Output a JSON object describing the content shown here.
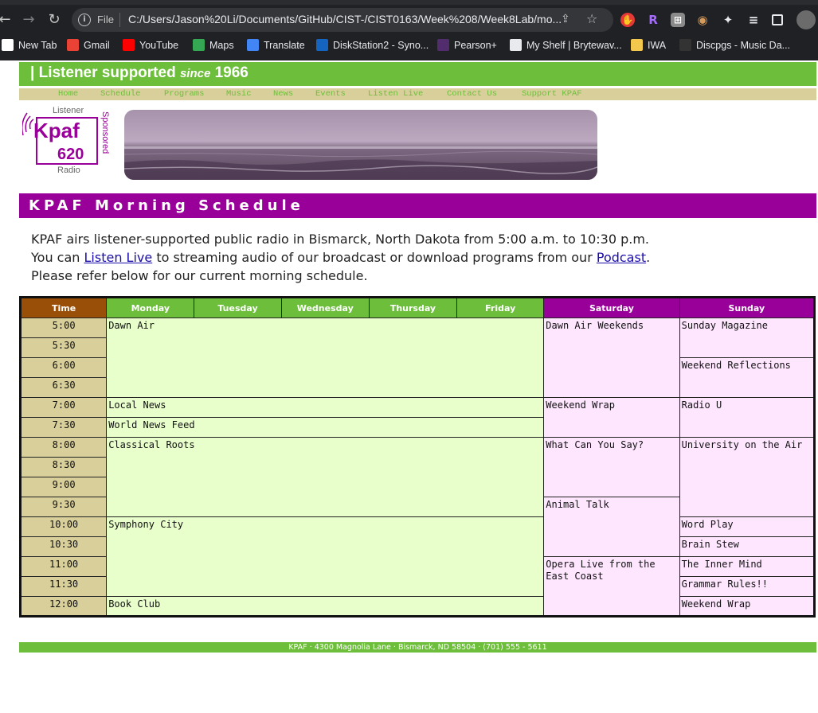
{
  "browser": {
    "url_scheme": "File",
    "url": "C:/Users/Jason%20Li/Documents/GitHub/CIST-/CIST0163/Week%208/Week8Lab/mo...",
    "bookmarks": [
      {
        "label": "New Tab",
        "icon": "grid-icon",
        "color": "#ffffff"
      },
      {
        "label": "Gmail",
        "icon": "gmail-icon",
        "color": "#ea4335"
      },
      {
        "label": "YouTube",
        "icon": "youtube-icon",
        "color": "#ff0000"
      },
      {
        "label": "Maps",
        "icon": "maps-icon",
        "color": "#34a853"
      },
      {
        "label": "Translate",
        "icon": "translate-icon",
        "color": "#4285f4"
      },
      {
        "label": "DiskStation2 - Syno...",
        "icon": "dsm-icon",
        "color": "#1565c0"
      },
      {
        "label": "Pearson+",
        "icon": "pearson-icon",
        "color": "#512d6d"
      },
      {
        "label": "My Shelf | Brytewav...",
        "icon": "doc-icon",
        "color": "#e8eaed"
      },
      {
        "label": "IWA",
        "icon": "folder-icon",
        "color": "#f2c94c"
      },
      {
        "label": "Discpgs - Music Da...",
        "icon": "discogs-icon",
        "color": "#333333"
      }
    ]
  },
  "site": {
    "tagline_prefix": "| Listener supported",
    "tagline_since": "since",
    "tagline_year": "1966",
    "nav": [
      "Home",
      "Schedule",
      "Programs",
      "Music",
      "News",
      "Events",
      "Listen Live",
      "Contact Us",
      "Support KPAF"
    ],
    "logo": {
      "top": "Listener",
      "name": "Kpaf",
      "freq": "620",
      "bottom": "Radio",
      "side": "Sponsored"
    },
    "heading": "KPAF Morning Schedule",
    "intro": {
      "line1": "KPAF airs listener-supported public radio in Bismarck, North Dakota from 5:00 a.m. to 10:30 p.m.",
      "line2_before": "You can",
      "line2_link1": "Listen Live",
      "line2_mid": "to streaming audio of our broadcast or download programs from our",
      "line2_link2": "Podcast",
      "line2_after": ".",
      "line3": "Please refer below for our current morning schedule."
    },
    "footer": "KPAF · 4300 Magnolia Lane · Bismarck, ND 58504 · (701) 555 - 5611",
    "colors": {
      "green": "#6dbf3b",
      "purple": "#990099",
      "tan": "#d8cf9a",
      "brown": "#9a4f08",
      "weekday_cell": "#e8ffcc",
      "weekend_cell": "#ffe6ff"
    }
  },
  "schedule": {
    "headers": {
      "time": "Time",
      "weekdays": [
        "Monday",
        "Tuesday",
        "Wednesday",
        "Thursday",
        "Friday"
      ],
      "saturday": "Saturday",
      "sunday": "Sunday"
    },
    "times": [
      "5:00",
      "5:30",
      "6:00",
      "6:30",
      "7:00",
      "7:30",
      "8:00",
      "8:30",
      "9:00",
      "9:30",
      "10:00",
      "10:30",
      "11:00",
      "11:30",
      "12:00"
    ],
    "weekday_programs": [
      {
        "title": "Dawn Air",
        "start": 0,
        "slots": 4
      },
      {
        "title": "Local News",
        "start": 4,
        "slots": 1
      },
      {
        "title": "World News Feed",
        "start": 5,
        "slots": 1
      },
      {
        "title": "Classical Roots",
        "start": 6,
        "slots": 4
      },
      {
        "title": "Symphony City",
        "start": 10,
        "slots": 4
      },
      {
        "title": "Book Club",
        "start": 14,
        "slots": 1
      }
    ],
    "saturday_programs": [
      {
        "title": "Dawn Air Weekends",
        "start": 0,
        "slots": 4
      },
      {
        "title": "Weekend Wrap",
        "start": 4,
        "slots": 2
      },
      {
        "title": "What Can You Say?",
        "start": 6,
        "slots": 3
      },
      {
        "title": "Animal Talk",
        "start": 9,
        "slots": 3
      },
      {
        "title": "Opera Live from the East Coast",
        "start": 12,
        "slots": 3
      }
    ],
    "sunday_programs": [
      {
        "title": "Sunday Magazine",
        "start": 0,
        "slots": 2
      },
      {
        "title": "Weekend Reflections",
        "start": 2,
        "slots": 2
      },
      {
        "title": "Radio U",
        "start": 4,
        "slots": 2
      },
      {
        "title": "University on the Air",
        "start": 6,
        "slots": 4
      },
      {
        "title": "Word Play",
        "start": 10,
        "slots": 1
      },
      {
        "title": "Brain Stew",
        "start": 11,
        "slots": 1
      },
      {
        "title": "The Inner Mind",
        "start": 12,
        "slots": 1
      },
      {
        "title": "Grammar Rules!!",
        "start": 13,
        "slots": 1
      },
      {
        "title": "Weekend Wrap",
        "start": 14,
        "slots": 1
      }
    ]
  }
}
